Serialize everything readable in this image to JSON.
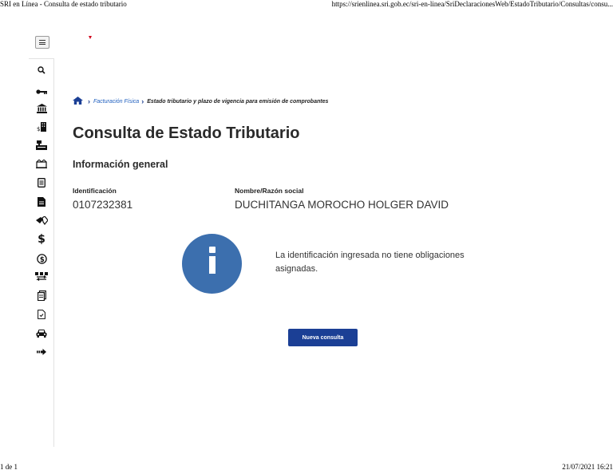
{
  "print_header": {
    "title": "SRI en Línea - Consulta de estado tributario",
    "url": "https://srienlinea.sri.gob.ec/sri-en-linea/SriDeclaracionesWeb/EstadoTributario/Consultas/consu..."
  },
  "print_footer": {
    "page": "1 de 1",
    "datetime": "21/07/2021 16:21"
  },
  "sidebar": {
    "icons": [
      "search-icon",
      "key-icon",
      "bank-icon",
      "building-dollar-icon",
      "cash-register-icon",
      "open-box-icon",
      "document-list-icon",
      "document-filled-icon",
      "handshake-icon",
      "dollar-icon",
      "circled-dollar-icon",
      "money-exchange-icon",
      "document-stack-icon",
      "document-check-icon",
      "car-icon",
      "arrow-right-icon"
    ],
    "dollar_glyph": "$"
  },
  "breadcrumb": {
    "link": "Facturación Física",
    "current": "Estado tributario y plazo de vigencia para emisión de comprobantes"
  },
  "page": {
    "title": "Consulta de Estado Tributario",
    "section": "Información general"
  },
  "fields": {
    "identificacion_label": "Identificación",
    "identificacion_value": "0107232381",
    "nombre_label": "Nombre/Razón social",
    "nombre_value": "DUCHITANGA MOROCHO HOLGER DAVID"
  },
  "message": {
    "text": "La identificación ingresada no tiene obligaciones asignadas."
  },
  "actions": {
    "new_query": "Nueva consulta"
  },
  "colors": {
    "primary": "#1b3f95",
    "info": "#3c6fae",
    "link": "#1f5fbf",
    "brand_red": "#d0021b"
  }
}
